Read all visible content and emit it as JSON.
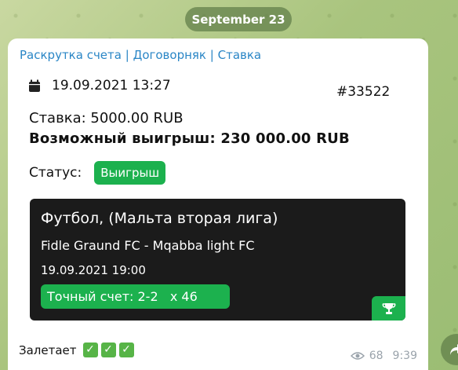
{
  "date_pill": "September 23",
  "message": {
    "links": [
      "Раскрутка счета",
      "Договорняк",
      "Ставка"
    ],
    "link_separator": "|",
    "datetime": "19.09.2021 13:27",
    "ticket_id": "#33522",
    "stake": "Ставка: 5000.00 RUB",
    "possible_win": "Возможный выигрыш: 230 000.00 RUB",
    "status_label": "Статус:",
    "status_value": "Выигрыш",
    "card": {
      "sport": "Футбол, (Мальта вторая лига)",
      "teams": "Fidle Graund FC - Mqabba light FC",
      "match_time": "19.09.2021 19:00",
      "bet": "Точный счет: 2-2   x 46"
    },
    "caption_text": "Залетает",
    "checkmark_glyph": "✓",
    "views": "68",
    "time": "9:39"
  },
  "colors": {
    "accent_green": "#1cb14e",
    "link_blue": "#2a86c6"
  },
  "icons": [
    "calendar-icon",
    "trophy-icon",
    "eye-icon",
    "share-icon",
    "check-mark-icon"
  ]
}
